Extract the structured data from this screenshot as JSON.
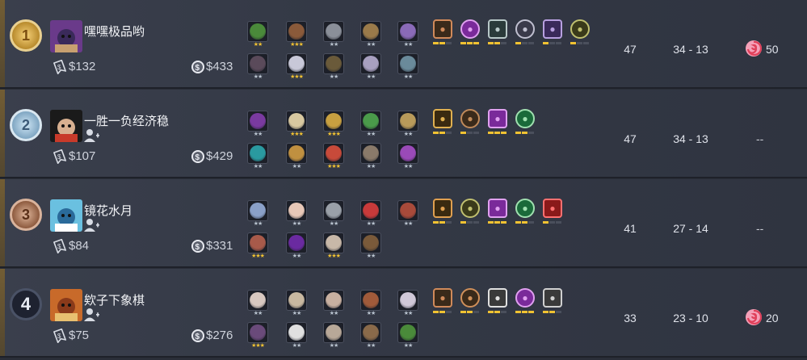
{
  "players": [
    {
      "rank": "1",
      "rank_style": "gold",
      "name": "嘿嘿极品哟",
      "has_friend_icon": false,
      "gold": "$132",
      "networth": "$433",
      "level": "47",
      "record": "34 - 13",
      "candy": "50",
      "heroes": [
        {
          "icon": "hero-green-eyes",
          "color": "#4a8a3a",
          "stars": 2,
          "star_color": "#f1c232"
        },
        {
          "icon": "hero-brown-hair",
          "color": "#8a5a3a",
          "stars": 3,
          "star_color": "#f1c232"
        },
        {
          "icon": "hero-grey-beast",
          "color": "#8a8f99",
          "stars": 2,
          "star_color": "#b9c3cf"
        },
        {
          "icon": "hero-tree",
          "color": "#9a7a4a",
          "stars": 2,
          "star_color": "#b9c3cf"
        },
        {
          "icon": "hero-purple-hood",
          "color": "#8a6ab8",
          "stars": 2,
          "star_color": "#b9c3cf"
        },
        {
          "icon": "hero-dark-rogue",
          "color": "#5a4a5a",
          "stars": 2,
          "star_color": "#b9c3cf"
        },
        {
          "icon": "hero-white-hair",
          "color": "#c8c8d8",
          "stars": 3,
          "star_color": "#f1c232"
        },
        {
          "icon": "hero-witch-hat",
          "color": "#6a5a3a",
          "stars": 2,
          "star_color": "#b9c3cf"
        },
        {
          "icon": "hero-viking",
          "color": "#a8a0c0",
          "stars": 2,
          "star_color": "#b9c3cf"
        },
        {
          "icon": "hero-robot",
          "color": "#6a8a9a",
          "stars": 2,
          "star_color": "#b9c3cf"
        }
      ],
      "synergies": [
        {
          "icon": "knight-icon",
          "bg": "#3a2a1a",
          "fg": "#d08a5a",
          "bar": "#f1c232",
          "filled": 2,
          "total": 3
        },
        {
          "icon": "demon-icon",
          "bg": "#7a2a9a",
          "fg": "#e0a0f0",
          "bar": "#f1c232",
          "filled": 3,
          "total": 3
        },
        {
          "icon": "beast-icon",
          "bg": "#2a3a3a",
          "fg": "#b8c8c8",
          "bar": "#f1c232",
          "filled": 2,
          "total": 3
        },
        {
          "icon": "mech-icon",
          "bg": "#3a3a4a",
          "fg": "#c0c0d0",
          "bar": "#f1c232",
          "filled": 1,
          "total": 3
        },
        {
          "icon": "mage-icon",
          "bg": "#3a2a5a",
          "fg": "#b8a0e0",
          "bar": "#f1c232",
          "filled": 1,
          "total": 3
        },
        {
          "icon": "goblin-icon",
          "bg": "#3a3a1a",
          "fg": "#c0c070",
          "bar": "#f1c232",
          "filled": 1,
          "total": 3
        }
      ]
    },
    {
      "rank": "2",
      "rank_style": "silver",
      "name": "一胜一负经济稳",
      "has_friend_icon": true,
      "gold": "$107",
      "networth": "$429",
      "level": "47",
      "record": "34 - 13",
      "candy": "--",
      "heroes": [
        {
          "icon": "hero-bat",
          "color": "#7a3aa0",
          "stars": 2,
          "star_color": "#b9c3cf"
        },
        {
          "icon": "hero-cowboy",
          "color": "#d8c8a0",
          "stars": 3,
          "star_color": "#f1c232"
        },
        {
          "icon": "hero-gold-knight",
          "color": "#c8a040",
          "stars": 3,
          "star_color": "#f1c232"
        },
        {
          "icon": "hero-green-bandit",
          "color": "#4a9a4a",
          "stars": 2,
          "star_color": "#b9c3cf"
        },
        {
          "icon": "hero-helm",
          "color": "#b89a5a",
          "stars": 2,
          "star_color": "#b9c3cf"
        },
        {
          "icon": "hero-teal-orb",
          "color": "#2a9aa0",
          "stars": 2,
          "star_color": "#b9c3cf"
        },
        {
          "icon": "hero-gold-hood",
          "color": "#c09040",
          "stars": 2,
          "star_color": "#b9c3cf"
        },
        {
          "icon": "hero-red-ape",
          "color": "#c84a3a",
          "stars": 3,
          "star_color": "#f1c232"
        },
        {
          "icon": "hero-horned-beast",
          "color": "#8a7a6a",
          "stars": 2,
          "star_color": "#b9c3cf"
        },
        {
          "icon": "hero-purple-witch",
          "color": "#9a4ab8",
          "stars": 2,
          "star_color": "#b9c3cf"
        }
      ],
      "synergies": [
        {
          "icon": "warrior-icon",
          "bg": "#3a2a10",
          "fg": "#e0b050",
          "bar": "#f1c232",
          "filled": 2,
          "total": 3
        },
        {
          "icon": "insect-icon",
          "bg": "#3a2a1a",
          "fg": "#c08a5a",
          "bar": "#f1c232",
          "filled": 1,
          "total": 3
        },
        {
          "icon": "demon-icon",
          "bg": "#7a2a9a",
          "fg": "#e0a0f0",
          "bar": "#f1c232",
          "filled": 3,
          "total": 3
        },
        {
          "icon": "beast-icon",
          "bg": "#1a6a3a",
          "fg": "#a0e0b0",
          "bar": "#f1c232",
          "filled": 2,
          "total": 3
        }
      ]
    },
    {
      "rank": "3",
      "rank_style": "bronze",
      "name": "镜花水月",
      "has_friend_icon": true,
      "gold": "$84",
      "networth": "$331",
      "level": "41",
      "record": "27 - 14",
      "candy": "--",
      "heroes": [
        {
          "icon": "hero-blue-ghost",
          "color": "#8aa0c8",
          "stars": 2,
          "star_color": "#b9c3cf"
        },
        {
          "icon": "hero-pale-chef",
          "color": "#e8c8b8",
          "stars": 2,
          "star_color": "#b9c3cf"
        },
        {
          "icon": "hero-grey-bird",
          "color": "#9aa0a8",
          "stars": 2,
          "star_color": "#b9c3cf"
        },
        {
          "icon": "hero-red-devil",
          "color": "#c83a3a",
          "stars": 2,
          "star_color": "#b9c3cf"
        },
        {
          "icon": "hero-red-cap",
          "color": "#a84a3a",
          "stars": 2,
          "star_color": "#b9c3cf"
        },
        {
          "icon": "hero-bearded",
          "color": "#a85a4a",
          "stars": 3,
          "star_color": "#f1c232"
        },
        {
          "icon": "hero-purple-shade",
          "color": "#6a2aa0",
          "stars": 2,
          "star_color": "#b9c3cf"
        },
        {
          "icon": "hero-owl",
          "color": "#c8b8a8",
          "stars": 3,
          "star_color": "#f1c232"
        },
        {
          "icon": "hero-brown-bear",
          "color": "#7a5a3a",
          "stars": 2,
          "star_color": "#b9c3cf"
        }
      ],
      "synergies": [
        {
          "icon": "hunter-icon",
          "bg": "#3a2a10",
          "fg": "#e0a050",
          "bar": "#f1c232",
          "filled": 2,
          "total": 3
        },
        {
          "icon": "goblin-icon",
          "bg": "#3a3a1a",
          "fg": "#c0c070",
          "bar": "#f1c232",
          "filled": 1,
          "total": 3
        },
        {
          "icon": "demon-icon",
          "bg": "#7a2a9a",
          "fg": "#e0a0f0",
          "bar": "#f1c232",
          "filled": 3,
          "total": 3
        },
        {
          "icon": "beast-icon",
          "bg": "#1a6a3a",
          "fg": "#a0e0b0",
          "bar": "#f1c232",
          "filled": 2,
          "total": 3
        },
        {
          "icon": "dragon-icon",
          "bg": "#8a1a1a",
          "fg": "#ff7070",
          "bar": "#f1c232",
          "filled": 1,
          "total": 3
        }
      ]
    },
    {
      "rank": "4",
      "rank_style": "plain",
      "name": "欸子下象棋",
      "has_friend_icon": true,
      "gold": "$75",
      "networth": "$276",
      "level": "33",
      "record": "23 - 10",
      "candy": "20",
      "heroes": [
        {
          "icon": "hero-pale-lady",
          "color": "#d8c8c0",
          "stars": 2,
          "star_color": "#b9c3cf"
        },
        {
          "icon": "hero-bull",
          "color": "#c8b8a0",
          "stars": 2,
          "star_color": "#b9c3cf"
        },
        {
          "icon": "hero-mustache",
          "color": "#c8b0a0",
          "stars": 2,
          "star_color": "#b9c3cf"
        },
        {
          "icon": "hero-monkey",
          "color": "#a05a3a",
          "stars": 2,
          "star_color": "#b9c3cf"
        },
        {
          "icon": "hero-silver-hair",
          "color": "#d0c8d8",
          "stars": 2,
          "star_color": "#b9c3cf"
        },
        {
          "icon": "hero-masked",
          "color": "#6a4a7a",
          "stars": 3,
          "star_color": "#f1c232"
        },
        {
          "icon": "hero-panda",
          "color": "#e0e0e0",
          "stars": 2,
          "star_color": "#b9c3cf"
        },
        {
          "icon": "hero-old-man",
          "color": "#b8a898",
          "stars": 2,
          "star_color": "#b9c3cf"
        },
        {
          "icon": "hero-fur-hood",
          "color": "#8a6a4a",
          "stars": 2,
          "star_color": "#b9c3cf"
        },
        {
          "icon": "hero-green-eyes",
          "color": "#4a8a3a",
          "stars": 2,
          "star_color": "#b9c3cf"
        }
      ],
      "synergies": [
        {
          "icon": "knight-icon",
          "bg": "#3a2a1a",
          "fg": "#d08a5a",
          "bar": "#f1c232",
          "filled": 2,
          "total": 3
        },
        {
          "icon": "assassin-icon",
          "bg": "#3a2a1a",
          "fg": "#d0905a",
          "bar": "#f1c232",
          "filled": 2,
          "total": 3
        },
        {
          "icon": "pandaren-icon",
          "bg": "#3a3a3a",
          "fg": "#e0e0e0",
          "bar": "#f1c232",
          "filled": 2,
          "total": 3
        },
        {
          "icon": "demon-icon",
          "bg": "#7a2a9a",
          "fg": "#e0a0f0",
          "bar": "#f1c232",
          "filled": 3,
          "total": 3
        },
        {
          "icon": "hat-icon",
          "bg": "#3a3a3a",
          "fg": "#d0d0d0",
          "bar": "#f1c232",
          "filled": 2,
          "total": 3
        }
      ]
    }
  ]
}
